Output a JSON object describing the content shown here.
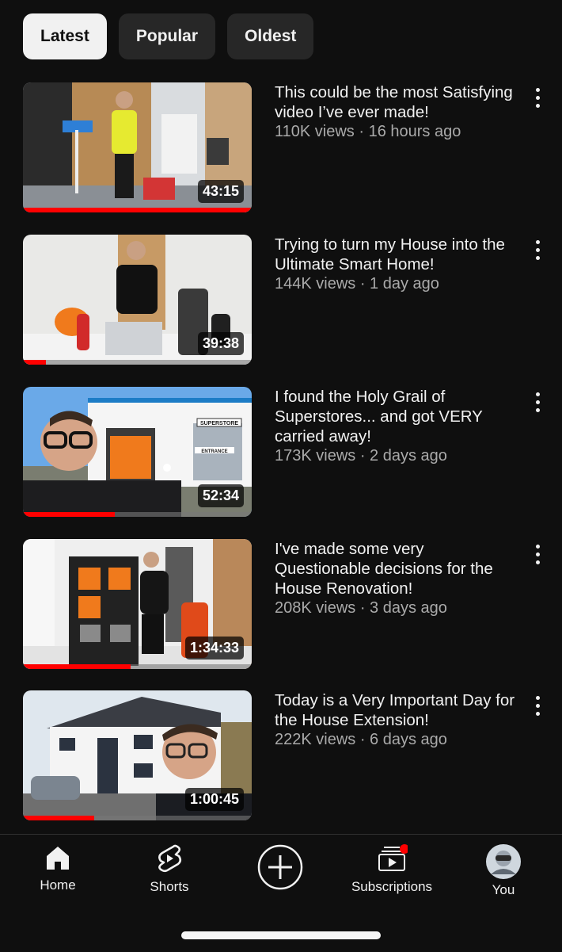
{
  "filters": {
    "chips": [
      {
        "label": "Latest",
        "active": true
      },
      {
        "label": "Popular",
        "active": false
      },
      {
        "label": "Oldest",
        "active": false
      }
    ]
  },
  "videos": [
    {
      "title": "This could be the most Satisfying video I’ve ever made!",
      "stats": "110K views · 16 hours ago",
      "duration": "43:15",
      "watched_fraction": 1.0
    },
    {
      "title": "Trying to turn my House into the Ultimate Smart Home!",
      "stats": "144K views · 1 day ago",
      "duration": "39:38",
      "watched_fraction": 0.1
    },
    {
      "title": "I found the Holy Grail of Superstores... and got VERY carried away!",
      "stats": "173K views · 2 days ago",
      "duration": "52:34",
      "watched_fraction": 0.4
    },
    {
      "title": "I've made some very Questionable decisions for the House Renovation!",
      "stats": "208K views · 3 days ago",
      "duration": "1:34:33",
      "watched_fraction": 0.47
    },
    {
      "title": "Today is a Very Important Day for the House Extension!",
      "stats": "222K views · 6 days ago",
      "duration": "1:00:45",
      "watched_fraction": 0.31
    }
  ],
  "thumb_signs": {
    "superstore": "SUPERSTORE",
    "entrance": "ENTRANCE"
  },
  "nav": {
    "home": "Home",
    "shorts": "Shorts",
    "subscriptions": "Subscriptions",
    "you": "You"
  },
  "colors": {
    "background": "#0f0f0f",
    "progress": "#ff0000",
    "notification_dot": "#ff0000"
  }
}
